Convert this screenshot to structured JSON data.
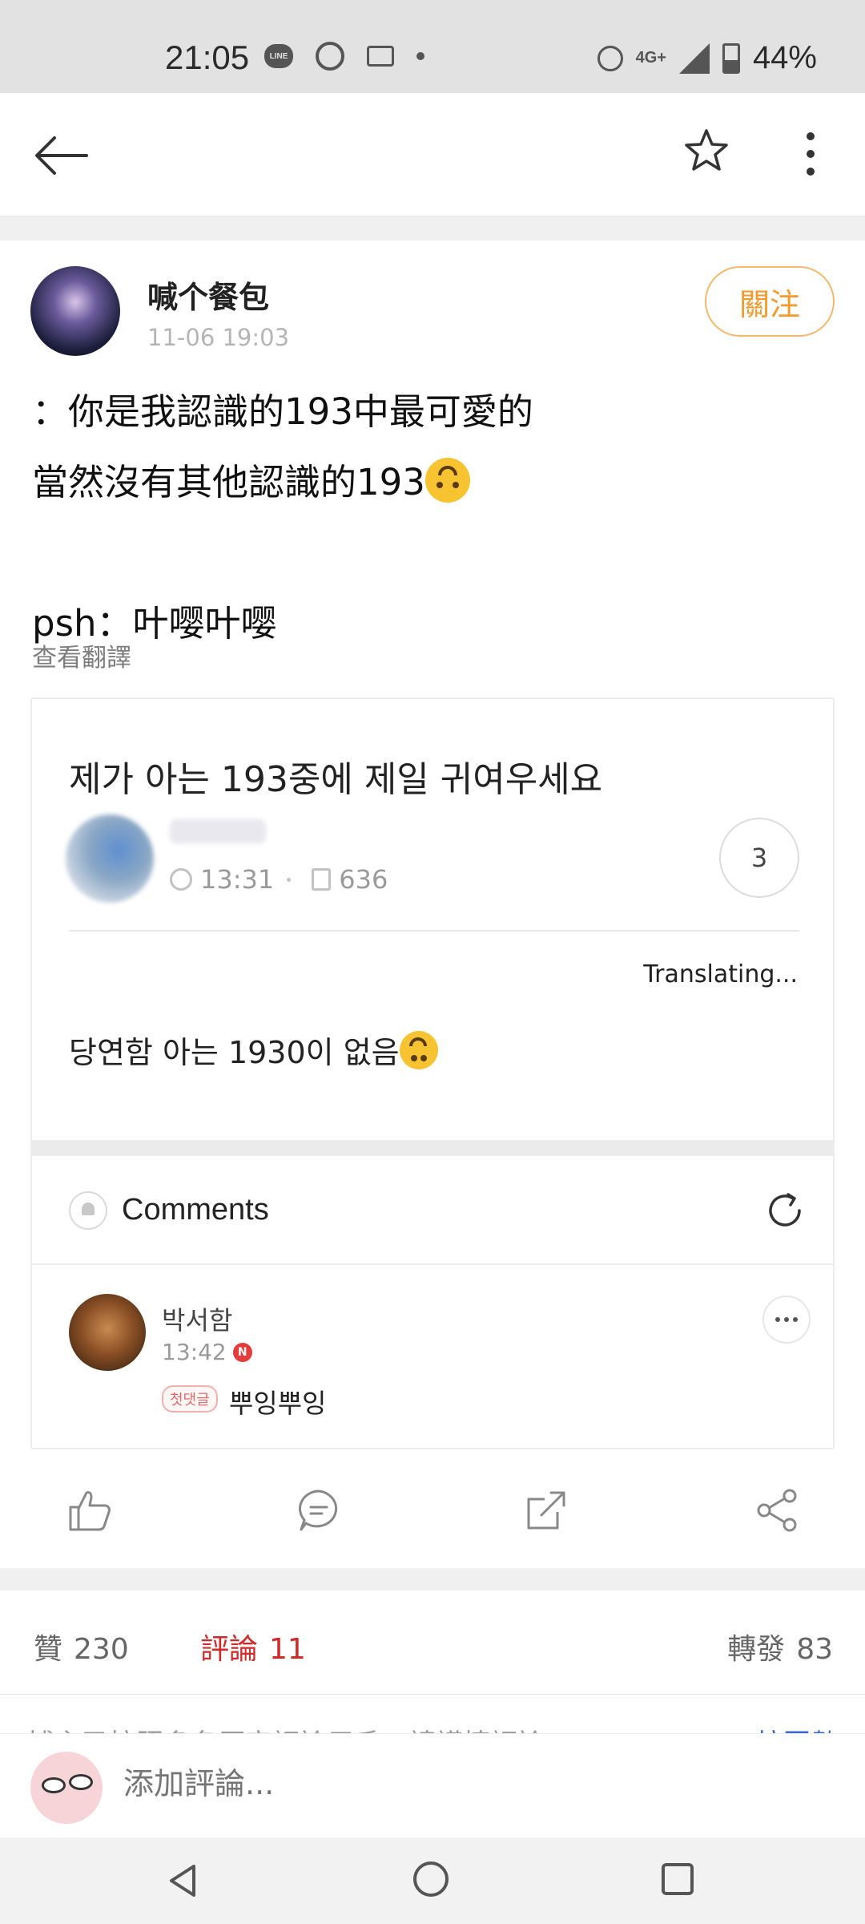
{
  "status_bar": {
    "time": "21:05",
    "line_label": "LINE",
    "network": "4G+",
    "battery": "44%"
  },
  "top_bar": {
    "icons": [
      "back-arrow-icon",
      "star-icon",
      "more-vertical-icon"
    ]
  },
  "post": {
    "author": "喊个餐包",
    "timestamp": "11-06 19:03",
    "follow_label": "關注",
    "lines": [
      "：你是我認識的193中最可愛的",
      "當然沒有其他認識的193",
      "psh：叶嘤叶嘤"
    ],
    "translate_label": "查看翻譯"
  },
  "embed": {
    "title": "제가 아는 193중에 제일 귀여우세요",
    "time": "13:31",
    "views": "636",
    "comment_count": "3",
    "translating": "Translating...",
    "body": "당연함 아는 1930이 없음",
    "comments_label": "Comments",
    "comment": {
      "name": "박서함",
      "time": "13:42",
      "badge": "N",
      "tag": "첫댓글",
      "text": "뿌잉뿌잉"
    }
  },
  "actions": {
    "icons": [
      "like-icon",
      "comment-icon",
      "repost-icon",
      "share-icon"
    ]
  },
  "stats": {
    "likes_label": "贊",
    "likes": "230",
    "comments_label": "評論",
    "comments": "11",
    "reposts_label": "轉發",
    "reposts": "83"
  },
  "clipped": {
    "notice": "博主已按照多名原帝評論用戶，請謹慎評論",
    "sort": "按回數"
  },
  "input": {
    "placeholder": "添加評論..."
  },
  "colors": {
    "accent_orange": "#f39a2c",
    "active_red": "#d02a2a",
    "link_blue": "#3a6ad0"
  }
}
